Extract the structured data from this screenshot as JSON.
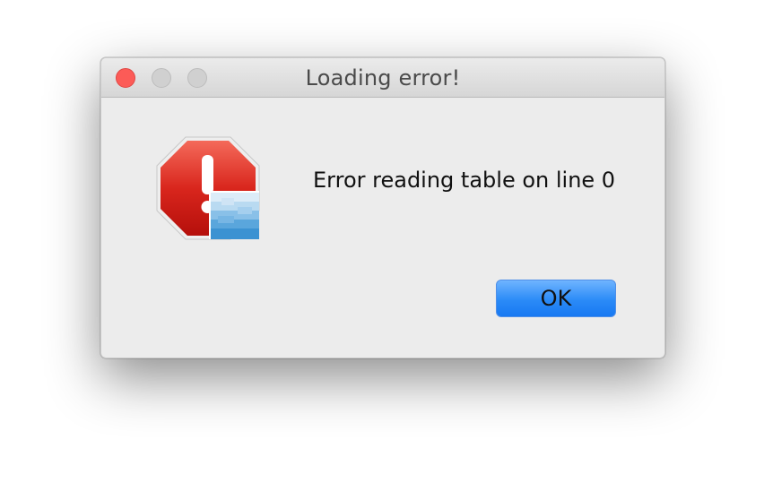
{
  "window": {
    "title": "Loading error!"
  },
  "traffic_lights": {
    "close": "close",
    "minimize": "minimize",
    "zoom": "zoom"
  },
  "dialog": {
    "icon": "stop-alert-icon",
    "message": "Error reading table on line 0",
    "ok_label": "OK"
  },
  "colors": {
    "close_button": "#fc5b57",
    "ok_button": "#2b8bf7",
    "dialog_background": "#ececec"
  }
}
